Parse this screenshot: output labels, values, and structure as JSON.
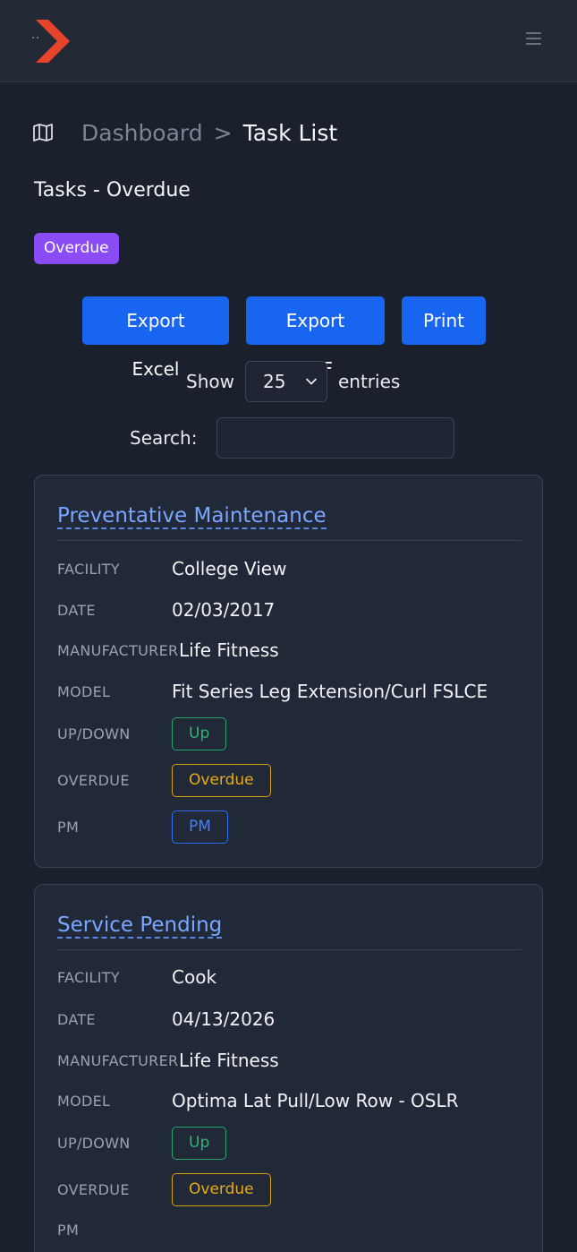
{
  "breadcrumb": {
    "home": "Dashboard",
    "separator": ">",
    "current": "Task List"
  },
  "page": {
    "title": "Tasks - Overdue",
    "status_badge": "Overdue"
  },
  "toolbar": {
    "export_excel": "Export Excel",
    "export_pdf": "Export PDF",
    "print": "Print"
  },
  "table_controls": {
    "show_label": "Show",
    "entries_value": "25",
    "entries_label": "entries",
    "search_label": "Search:",
    "search_value": ""
  },
  "field_labels": {
    "facility": "FACILITY",
    "date": "DATE",
    "manufacturer": "MANUFACTURER",
    "model": "MODEL",
    "updown": "UP/DOWN",
    "overdue": "OVERDUE",
    "pm": "PM"
  },
  "tasks": [
    {
      "title": "Preventative Maintenance",
      "facility": "College View",
      "date": "02/03/2017",
      "manufacturer": "Life Fitness",
      "model": "Fit Series Leg Extension/Curl FSLCE",
      "updown": "Up",
      "overdue": "Overdue",
      "pm": "PM"
    },
    {
      "title": "Service Pending",
      "facility": "Cook",
      "date": "04/13/2026",
      "manufacturer": "Life Fitness",
      "model": "Optima Lat Pull/Low Row - OSLR",
      "updown": "Up",
      "overdue": "Overdue",
      "pm": ""
    }
  ],
  "colors": {
    "background": "#1a202c",
    "topbar": "#232a36",
    "primary": "#1865f2",
    "badge_purple": "#8b4cf6",
    "link": "#7aa6ff",
    "success": "#22a865",
    "warning": "#d9a10a",
    "logo": "#e8442b"
  },
  "icons": {
    "logo": "chevron-logo",
    "menu": "hamburger-icon",
    "breadcrumb": "map-icon",
    "select": "chevron-down-icon"
  }
}
